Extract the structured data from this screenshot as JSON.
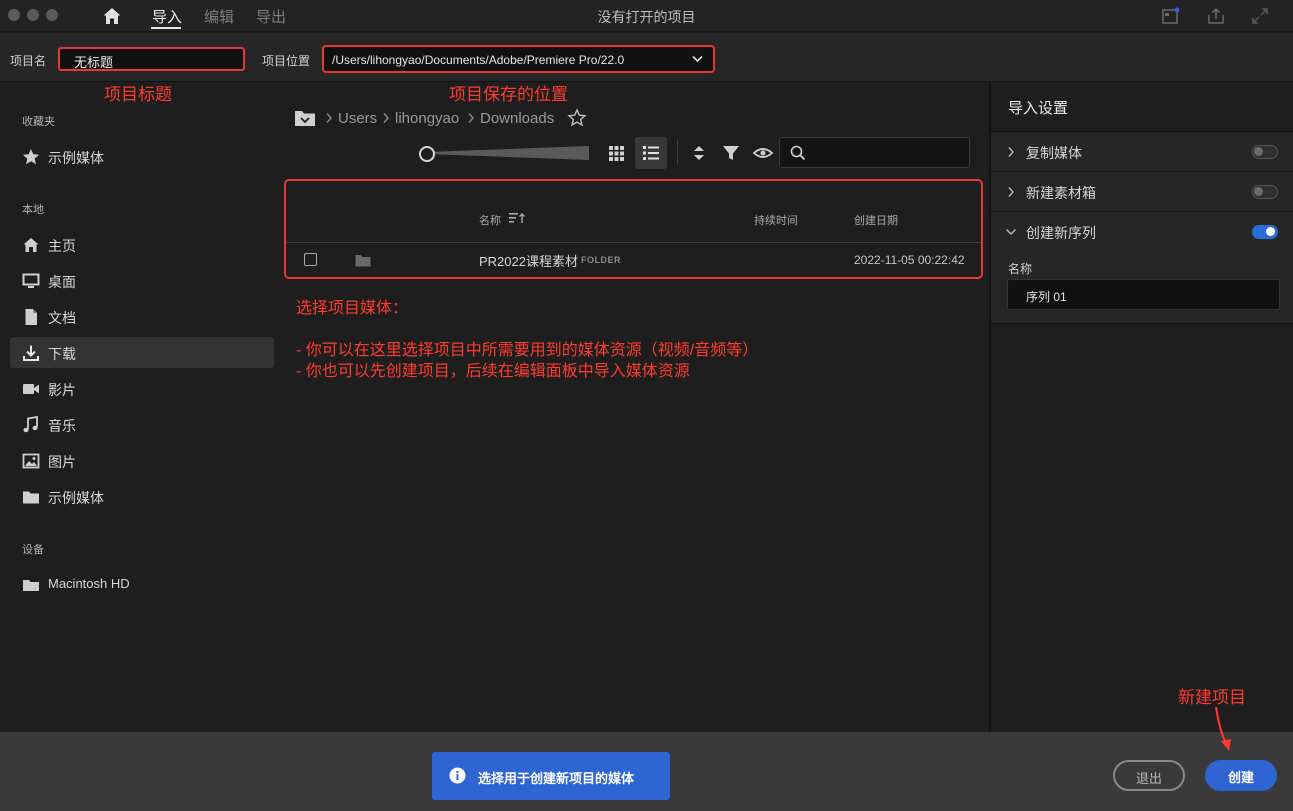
{
  "titlebar": {
    "tabs": [
      {
        "label": "导入",
        "active": true
      },
      {
        "label": "编辑",
        "active": false
      },
      {
        "label": "导出",
        "active": false
      }
    ],
    "window_title": "没有打开的项目"
  },
  "project_bar": {
    "name_label": "项目名",
    "name_value": "无标题",
    "location_label": "项目位置",
    "location_value": "/Users/lihongyao/Documents/Adobe/Premiere Pro/22.0"
  },
  "annotations": {
    "project_title": "项目标题",
    "save_location": "项目保存的位置",
    "select_media_heading": "选择项目媒体：",
    "select_media_line1": "- 你可以在这里选择项目中所需要用到的媒体资源（视频/音频等）",
    "select_media_line2": "- 你也可以先创建项目，后续在编辑面板中导入媒体资源",
    "new_project": "新建项目"
  },
  "sidebar": {
    "favorites_title": "收藏夹",
    "favorites": [
      {
        "label": "示例媒体",
        "icon": "star-icon"
      }
    ],
    "local_title": "本地",
    "local": [
      {
        "label": "主页",
        "icon": "home-icon"
      },
      {
        "label": "桌面",
        "icon": "desktop-icon"
      },
      {
        "label": "文档",
        "icon": "document-icon"
      },
      {
        "label": "下载",
        "icon": "download-icon",
        "active": true
      },
      {
        "label": "影片",
        "icon": "video-camera-icon"
      },
      {
        "label": "音乐",
        "icon": "music-note-icon"
      },
      {
        "label": "图片",
        "icon": "image-icon"
      },
      {
        "label": "示例媒体",
        "icon": "folder-icon"
      }
    ],
    "devices_title": "设备",
    "devices": [
      {
        "label": "Macintosh HD",
        "icon": "drive-icon"
      }
    ]
  },
  "browser": {
    "breadcrumb": [
      "Users",
      "lihongyao",
      "Downloads"
    ],
    "columns": {
      "name": "名称",
      "duration": "持续时间",
      "created": "创建日期"
    },
    "rows": [
      {
        "name": "PR2022课程素材",
        "type": "FOLDER",
        "duration": "",
        "created": "2022-11-05 00:22:42"
      }
    ],
    "search_placeholder": ""
  },
  "import_settings": {
    "title": "导入设置",
    "rows": [
      {
        "label": "复制媒体",
        "on": false,
        "expanded": false
      },
      {
        "label": "新建素材箱",
        "on": false,
        "expanded": false
      },
      {
        "label": "创建新序列",
        "on": true,
        "expanded": true
      }
    ],
    "sequence_name_label": "名称",
    "sequence_name_value": "序列 01"
  },
  "bottom_bar": {
    "info_text": "选择用于创建新项目的媒体",
    "exit_label": "退出",
    "create_label": "创建"
  },
  "colors": {
    "accent_blue": "#2f64d3",
    "annotation_red": "#ff3b30"
  }
}
